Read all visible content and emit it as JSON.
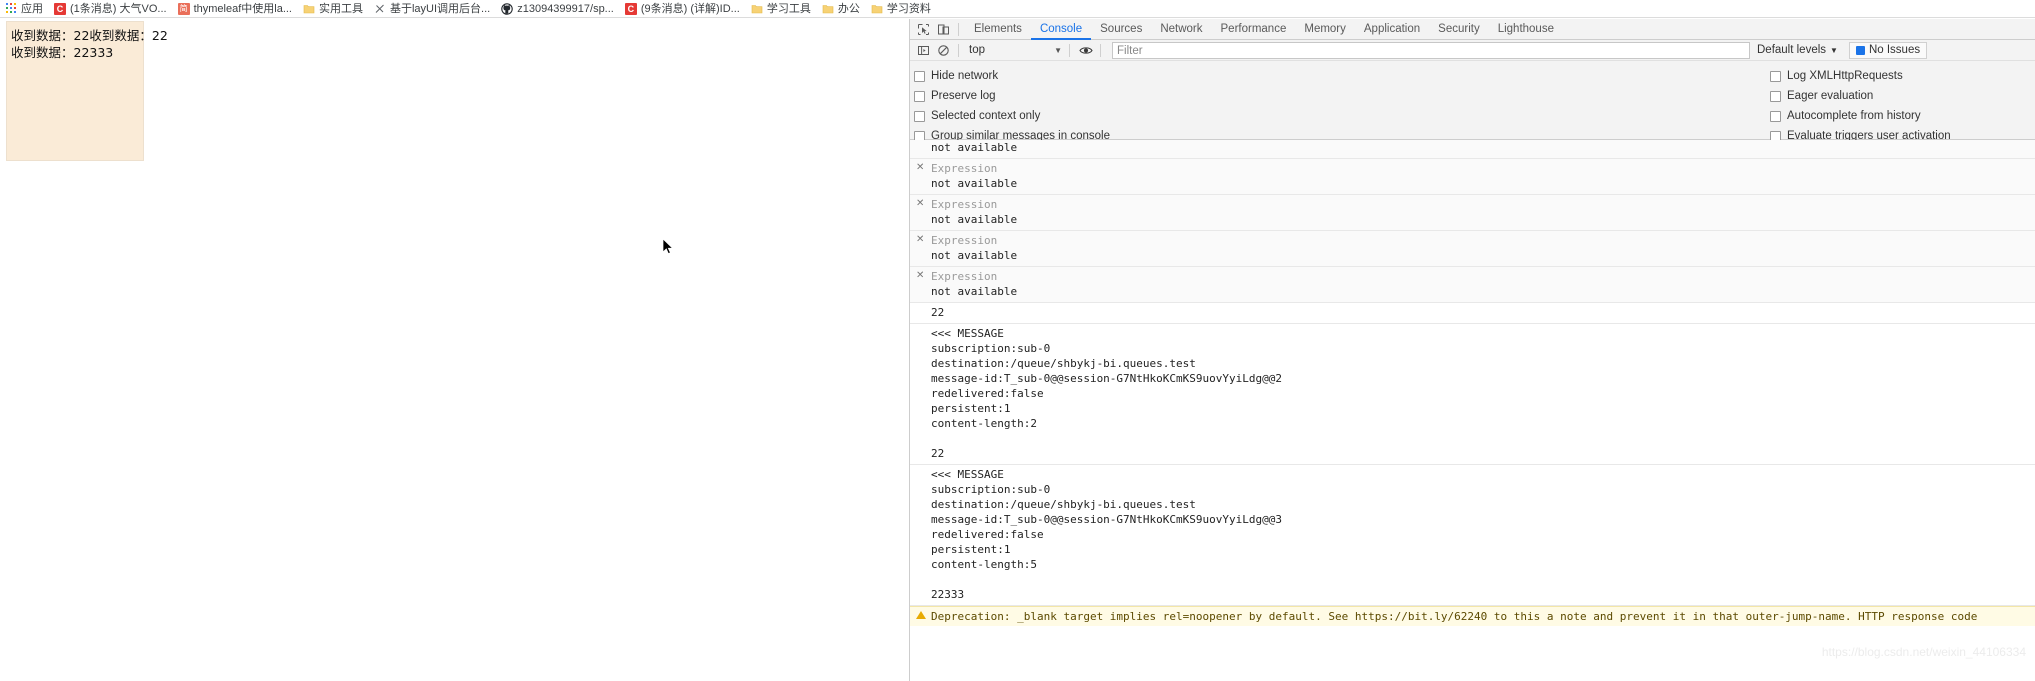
{
  "bookmarks": [
    {
      "icon": "apps-grid-icon",
      "label": "应用"
    },
    {
      "icon": "csdn-icon",
      "label": "(1条消息) 大气VO..."
    },
    {
      "icon": "jianshu-icon",
      "label": "thymeleaf中使用la..."
    },
    {
      "icon": "folder-icon",
      "label": "实用工具"
    },
    {
      "icon": "site-icon",
      "label": "基于layUI调用后台..."
    },
    {
      "icon": "github-icon",
      "label": "z13094399917/sp..."
    },
    {
      "icon": "csdn-icon",
      "label": "(9条消息) (详解)ID..."
    },
    {
      "icon": "folder-icon",
      "label": "学习工具"
    },
    {
      "icon": "folder-icon",
      "label": "办公"
    },
    {
      "icon": "folder-icon",
      "label": "学习资料"
    }
  ],
  "page": {
    "output_lines": [
      "收到数据：22收到数据：22",
      "收到数据：22333"
    ]
  },
  "devtools": {
    "toolbar_icons": [
      {
        "name": "inspect-element-icon"
      },
      {
        "name": "device-toolbar-icon"
      }
    ],
    "tabs": [
      {
        "label": "Elements",
        "active": false
      },
      {
        "label": "Console",
        "active": true
      },
      {
        "label": "Sources",
        "active": false
      },
      {
        "label": "Network",
        "active": false
      },
      {
        "label": "Performance",
        "active": false
      },
      {
        "label": "Memory",
        "active": false
      },
      {
        "label": "Application",
        "active": false
      },
      {
        "label": "Security",
        "active": false
      },
      {
        "label": "Lighthouse",
        "active": false
      }
    ],
    "console_toolbar": {
      "clear_icon": "clear-console-icon",
      "sidebar_icon": "console-sidebar-icon",
      "context": "top",
      "eye_icon": "live-expression-icon",
      "filter_placeholder": "Filter",
      "levels": "Default levels",
      "issues": "No Issues"
    },
    "settings": {
      "left": [
        "Hide network",
        "Preserve log",
        "Selected context only",
        "Group similar messages in console"
      ],
      "right": [
        "Log XMLHttpRequests",
        "Eager evaluation",
        "Autocomplete from history",
        "Evaluate triggers user activation"
      ]
    },
    "log": {
      "clipped_top": "not available",
      "errors": [
        {
          "title": "Expression",
          "body": "not available"
        },
        {
          "title": "Expression",
          "body": "not available"
        },
        {
          "title": "Expression",
          "body": "not available"
        },
        {
          "title": "Expression",
          "body": "not available"
        }
      ],
      "entries": [
        {
          "type": "plain",
          "text": "22"
        },
        {
          "type": "message",
          "text": "<<< MESSAGE\nsubscription:sub-0\ndestination:/queue/shbykj-bi.queues.test\nmessage-id:T_sub-0@@session-G7NtHkoKCmKS9uovYyiLdg@@2\nredelivered:false\npersistent:1\ncontent-length:2\n\n22"
        },
        {
          "type": "message",
          "text": "<<< MESSAGE\nsubscription:sub-0\ndestination:/queue/shbykj-bi.queues.test\nmessage-id:T_sub-0@@session-G7NtHkoKCmKS9uovYyiLdg@@3\nredelivered:false\npersistent:1\ncontent-length:5\n\n22333"
        }
      ],
      "warning": "Deprecation: _blank target implies rel=noopener by default. See https://bit.ly/62240 to this a note and prevent it in that outer-jump-name. HTTP response code"
    }
  },
  "watermark": "https://blog.csdn.net/weixin_44106334"
}
